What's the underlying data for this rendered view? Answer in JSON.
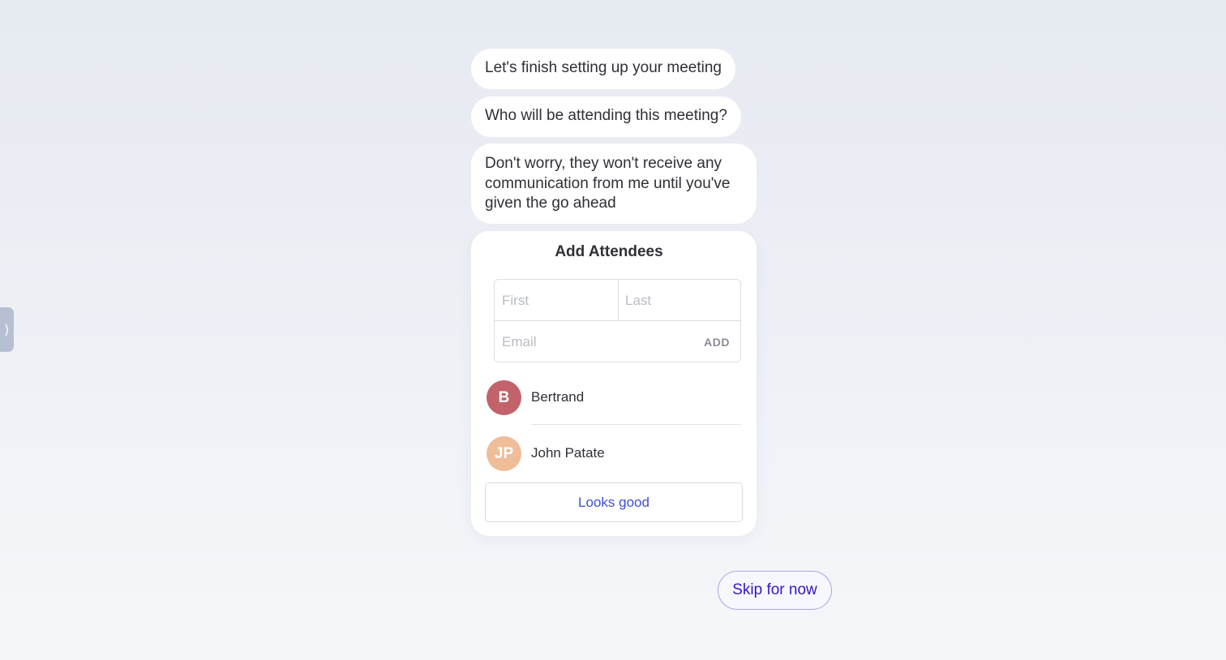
{
  "sidebar_toggle": {
    "glyph": "⟩",
    "icon": "chevron-right-icon"
  },
  "messages": [
    "Let's finish setting up your meeting",
    "Who will be attending this meeting?",
    "Don't worry, they won't receive any communication from me until you've given the go ahead"
  ],
  "attendees_card": {
    "title": "Add Attendees",
    "first_placeholder": "First",
    "last_placeholder": "Last",
    "email_placeholder": "Email",
    "add_label": "ADD",
    "attendees": [
      {
        "initials": "B",
        "name": "Bertrand",
        "color": "#c2636b"
      },
      {
        "initials": "JP",
        "name": "John Patate",
        "color": "#efbd98"
      }
    ],
    "confirm_label": "Looks good"
  },
  "skip_label": "Skip for now"
}
